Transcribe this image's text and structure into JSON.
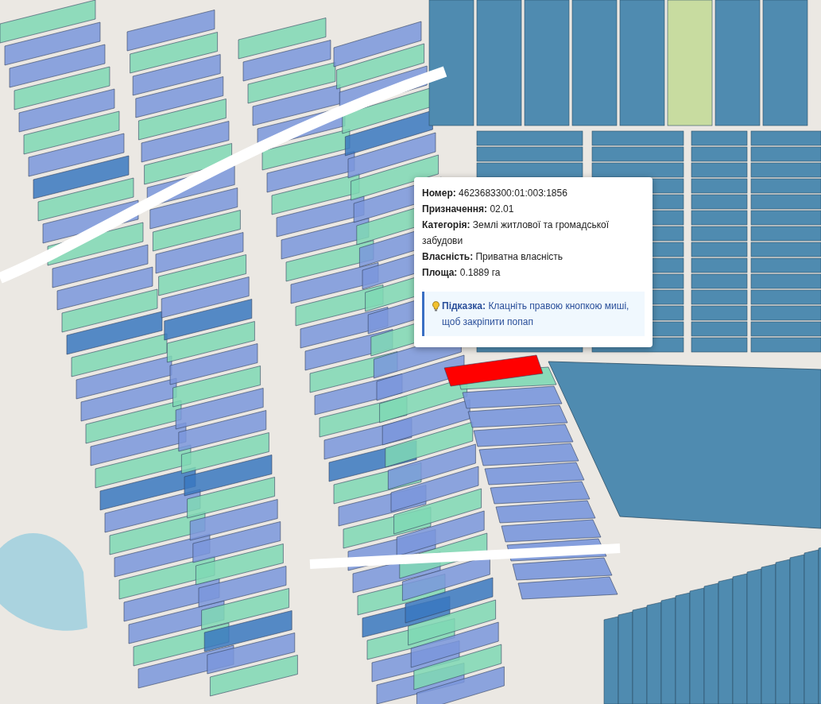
{
  "popup": {
    "fields": [
      {
        "text": "**Номер:** 4623683300:01:003:1856"
      },
      {
        "text": "**Призначення:** 02.01"
      },
      {
        "text": "**Категорія:** Землі житлової та громадської забудови"
      },
      {
        "text": "**Власність:** Приватна власність"
      },
      {
        "text": "**Площа:** 0.1889 га"
      }
    ],
    "hint": {
      "text": "**Підказка:** Клацніть правою кнопкою миші, щоб закріпити попап"
    }
  }
}
